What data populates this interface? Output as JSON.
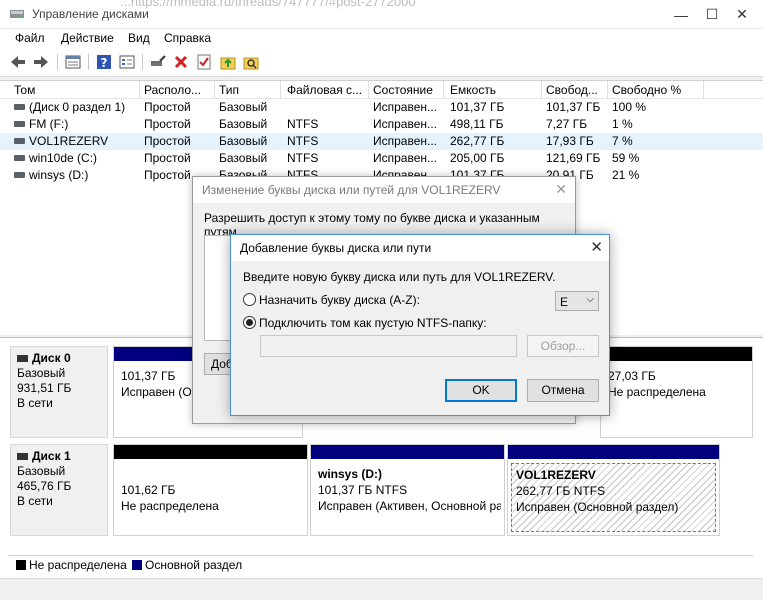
{
  "window": {
    "title": "Управление дисками",
    "bg_url_fragment": "...https://mmedia.ru/threads/747777/#post-2772000",
    "controls": {
      "minimize": "—",
      "maximize": "☐",
      "close": "✕"
    }
  },
  "menu": [
    "Файл",
    "Действие",
    "Вид",
    "Справка"
  ],
  "toolbar": [
    "back-icon",
    "forward-icon",
    "properties-icon",
    "help-icon",
    "list-view-icon",
    "connect-icon",
    "delete-icon",
    "check-icon",
    "folder-up-icon",
    "folder-search-icon"
  ],
  "volumes": {
    "columns": [
      "Том",
      "Располо...",
      "Тип",
      "Файловая с...",
      "Состояние",
      "Емкость",
      "Свобод...",
      "Свободно %"
    ],
    "rows": [
      [
        "(Диск 0 раздел 1)",
        "Простой",
        "Базовый",
        "",
        "Исправен...",
        "101,37 ГБ",
        "101,37 ГБ",
        "100 %"
      ],
      [
        "FM (F:)",
        "Простой",
        "Базовый",
        "NTFS",
        "Исправен...",
        "498,11 ГБ",
        "7,27 ГБ",
        "1 %"
      ],
      [
        "VOL1REZERV",
        "Простой",
        "Базовый",
        "NTFS",
        "Исправен...",
        "262,77 ГБ",
        "17,93 ГБ",
        "7 %"
      ],
      [
        "win10de (C:)",
        "Простой",
        "Базовый",
        "NTFS",
        "Исправен...",
        "205,00 ГБ",
        "121,69 ГБ",
        "59 %"
      ],
      [
        "winsys (D:)",
        "Простой",
        "Базовый",
        "NTFS",
        "Исправен...",
        "101,37 ГБ",
        "20,91 ГБ",
        "21 %"
      ]
    ]
  },
  "disks": [
    {
      "name": "Диск 0",
      "type": "Базовый",
      "size": "931,51 ГБ",
      "status": "В сети",
      "partitions": [
        {
          "title": "",
          "size": "101,37 ГБ",
          "status": "Исправен (Ос"
        },
        {
          "title": "",
          "size": "27,03 ГБ",
          "status": "Не распределена"
        }
      ]
    },
    {
      "name": "Диск 1",
      "type": "Базовый",
      "size": "465,76 ГБ",
      "status": "В сети",
      "partitions": [
        {
          "title": "",
          "size": "101,62 ГБ",
          "status": "Не распределена"
        },
        {
          "title": "winsys  (D:)",
          "size": "101,37 ГБ NTFS",
          "status": "Исправен (Активен, Основной ра"
        },
        {
          "title": "VOL1REZERV",
          "size": "262,77 ГБ NTFS",
          "status": "Исправен (Основной раздел)"
        }
      ]
    }
  ],
  "legend": {
    "unallocated": "Не распределена",
    "primary": "Основной раздел"
  },
  "colors": {
    "unallocated": "#000000",
    "primary": "#00007f",
    "selection": "#e5f3ff",
    "accent": "#0078d7"
  },
  "dialog_paths": {
    "title": "Изменение буквы диска или путей для VOL1REZERV",
    "description": "Разрешить доступ к этому тому по букве диска и указанным путям.",
    "add_button": "Добавить..."
  },
  "dialog_add": {
    "title": "Добавление буквы диска или пути",
    "prompt": "Введите новую букву диска или путь для VOL1REZERV.",
    "option_letter": "Назначить букву диска (A-Z):",
    "option_folder": "Подключить том как пустую NTFS-папку:",
    "letter_value": "E",
    "path_value": "",
    "browse_label": "Обзор...",
    "ok_label": "OK",
    "cancel_label": "Отмена"
  }
}
